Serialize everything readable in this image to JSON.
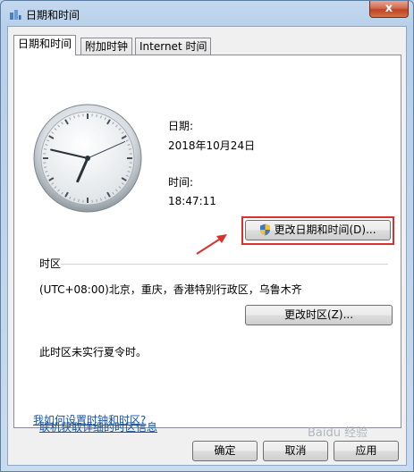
{
  "window": {
    "title": "日期和时间",
    "close_label": "x"
  },
  "tabs": [
    {
      "label": "日期和时间",
      "active": true
    },
    {
      "label": "附加时钟",
      "active": false
    },
    {
      "label": "Internet 时间",
      "active": false
    }
  ],
  "clock": {
    "hour": 18,
    "minute": 47,
    "second": 11
  },
  "date_section": {
    "label": "日期:",
    "value": "2018年10月24日"
  },
  "time_section": {
    "label": "时间:",
    "value": "18:47:11"
  },
  "buttons": {
    "change_datetime": "更改日期和时间(D)...",
    "change_timezone": "更改时区(Z)...",
    "ok": "确定",
    "cancel": "取消",
    "apply": "应用"
  },
  "timezone": {
    "heading": "时区",
    "value": "(UTC+08:00)北京，重庆，香港特别行政区，乌鲁木齐",
    "dst_note": "此时区未实行夏令时。"
  },
  "links": {
    "details": "联机获取详细的时区信息",
    "how_to": "我如何设置时钟和时区?"
  },
  "watermark": "Baidu 经验",
  "colors": {
    "highlight": "#d9322e",
    "link": "#1654a8"
  }
}
